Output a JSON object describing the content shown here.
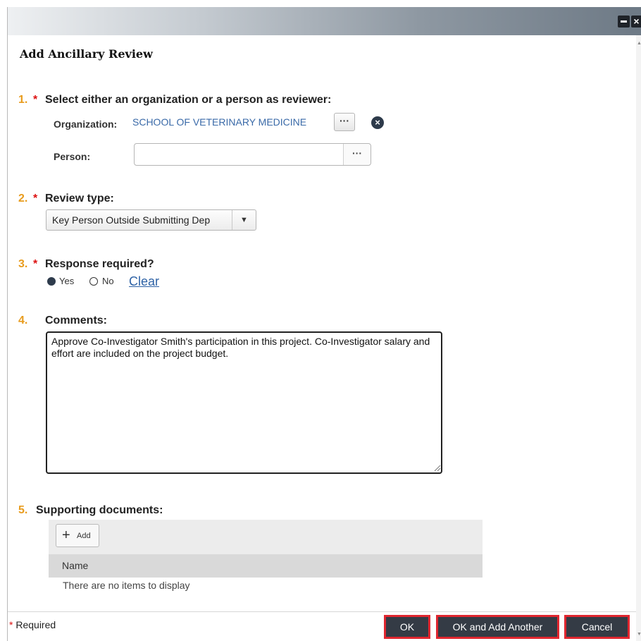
{
  "dialog": {
    "title": "Add Ancillary Review",
    "titlebar": {
      "minimize_icon": "minimize-icon",
      "close_icon": "close-icon"
    }
  },
  "q1": {
    "number": "1.",
    "required_mark": "*",
    "text": "Select either an organization or a person as reviewer:",
    "organization_label": "Organization:",
    "organization_value": "SCHOOL OF VETERINARY MEDICINE",
    "browse_label": "···",
    "person_label": "Person:",
    "person_value": ""
  },
  "q2": {
    "number": "2.",
    "required_mark": "*",
    "text": "Review type:",
    "selected": "Key Person Outside Submitting Dep"
  },
  "q3": {
    "number": "3.",
    "required_mark": "*",
    "text": "Response required?",
    "options": [
      {
        "label": "Yes",
        "checked": true
      },
      {
        "label": "No",
        "checked": false
      }
    ],
    "clear_label": "Clear"
  },
  "q4": {
    "number": "4.",
    "text": "Comments:",
    "value": "Approve Co-Investigator Smith's participation in this project. Co-Investigator salary and effort are included on the project budget."
  },
  "q5": {
    "number": "5.",
    "text": "Supporting documents:",
    "add_label": "Add",
    "column_header": "Name",
    "empty_text": "There are no items to display"
  },
  "footer": {
    "required_mark": "*",
    "required_label": "Required",
    "ok_label": "OK",
    "ok_add_label": "OK and Add Another",
    "cancel_label": "Cancel"
  },
  "colors": {
    "question_number": "#e89c1e",
    "required_mark": "#dd1111",
    "link": "#3a6aa8",
    "button_bg": "#343b45",
    "button_highlight": "#e0262f"
  }
}
